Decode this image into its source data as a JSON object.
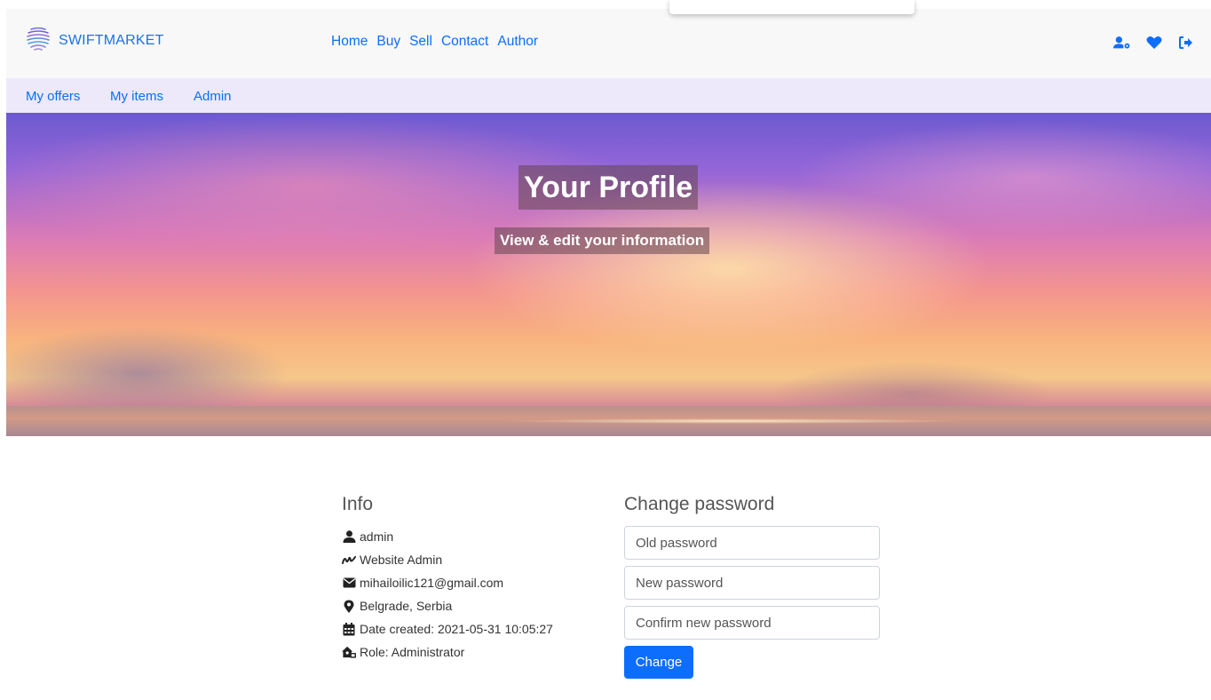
{
  "brand": {
    "name": "SWIFTMARKET",
    "icon": "globe-lines-logo-icon"
  },
  "nav": {
    "links": [
      "Home",
      "Buy",
      "Sell",
      "Contact",
      "Author"
    ]
  },
  "nav_icons": [
    {
      "name": "user-settings-icon"
    },
    {
      "name": "heart-icon"
    },
    {
      "name": "sign-out-icon"
    }
  ],
  "subnav": {
    "links": [
      "My offers",
      "My items",
      "Admin"
    ]
  },
  "hero": {
    "title": "Your Profile",
    "subtitle": "View & edit your information"
  },
  "info": {
    "heading": "Info",
    "rows": [
      {
        "icon": "user-icon",
        "text": "admin"
      },
      {
        "icon": "signature-icon",
        "text": "Website Admin"
      },
      {
        "icon": "envelope-icon",
        "text": "mihailoilic121@gmail.com"
      },
      {
        "icon": "map-marker-icon",
        "text": "Belgrade, Serbia"
      },
      {
        "icon": "calendar-icon",
        "text": "Date created: 2021-05-31 10:05:27"
      },
      {
        "icon": "house-user-icon",
        "text": "Role: Administrator"
      }
    ]
  },
  "password": {
    "heading": "Change password",
    "old_placeholder": "Old password",
    "new_placeholder": "New password",
    "confirm_placeholder": "Confirm new password",
    "button": "Change"
  },
  "colors": {
    "link": "#0d6efd",
    "button": "#0d6efd",
    "subnav_bg": "#ede9fa",
    "nav_bg": "#f8f8f8"
  }
}
